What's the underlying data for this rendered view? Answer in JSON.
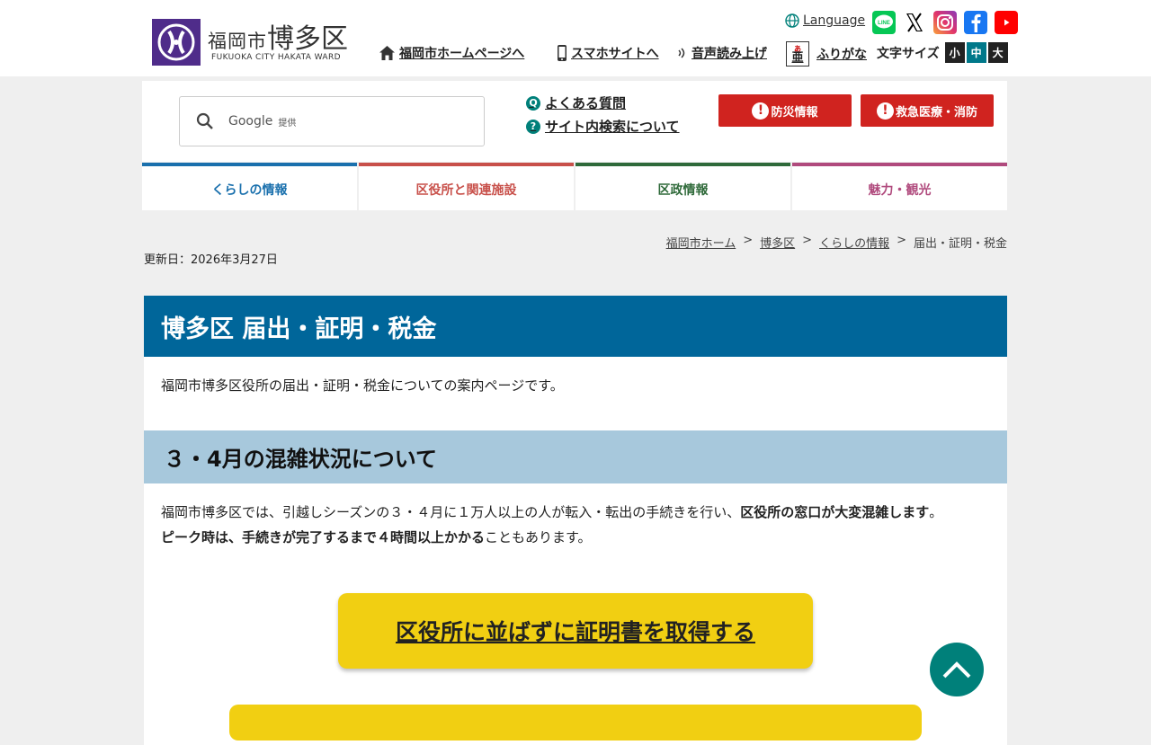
{
  "header": {
    "logo_city": "福岡市",
    "logo_ward": "博多区",
    "logo_sub": "FUKUOKA CITY HAKATA WARD",
    "language": "Language",
    "links": {
      "home": "福岡市ホームページへ",
      "smartphone": "スマホサイトへ",
      "read_aloud": "音声読み上げ",
      "furigana": "ふりがな"
    },
    "furigana_glyph": "亜",
    "furigana_ruby": "あ",
    "social": [
      "line-icon",
      "x-icon",
      "instagram-icon",
      "facebook-icon",
      "youtube-icon"
    ],
    "social_line_text": "LINE",
    "font_size_label": "文字サイズ",
    "font_sizes": [
      "小",
      "中",
      "大"
    ],
    "font_size_active": "中"
  },
  "search": {
    "google": "Google",
    "provided": "提供"
  },
  "help": {
    "faq": "よくある質問",
    "faq_badge": "Q",
    "site_search": "サイト内検索について",
    "site_search_badge": "?"
  },
  "alerts": {
    "disaster": "防災情報",
    "emergency": "救急医療・消防",
    "mark": "!"
  },
  "nav": {
    "tabs": [
      {
        "label": "くらしの情報",
        "color": "#1a70ad"
      },
      {
        "label": "区役所と関連施設",
        "color": "#c8504a"
      },
      {
        "label": "区政情報",
        "color": "#2f6a3a"
      },
      {
        "label": "魅力・観光",
        "color": "#b04a7d"
      }
    ]
  },
  "breadcrumb": {
    "items": [
      "福岡市ホーム",
      "博多区",
      "くらしの情報"
    ],
    "current": "届出・証明・税金",
    "separator": ">"
  },
  "updated": "更新日：2026年3月27日",
  "content": {
    "title": "博多区 届出・証明・税金",
    "intro": "福岡市博多区役所の届出・証明・税金についての案内ページです。",
    "section_heading": "３・4月の混雑状況について",
    "para1_normal": "福岡市博多区では、引越しシーズンの３・４月に１万人以上の人が転入・転出の手続きを行い、",
    "para1_bold": "区役所の窓口が大変混雑します",
    "para1_end": "。",
    "para2_bold": "ピーク時は、手続きが完了するまで４時間以上かかる",
    "para2_normal": "こともあります。",
    "cta": "区役所に並ばずに証明書を取得する"
  },
  "colors": {
    "title_bg": "#00669a",
    "heading_bg": "#a7c8dc",
    "cta_bg": "#f1cf12",
    "alert_red": "#d0231f",
    "teal": "#00807a"
  }
}
